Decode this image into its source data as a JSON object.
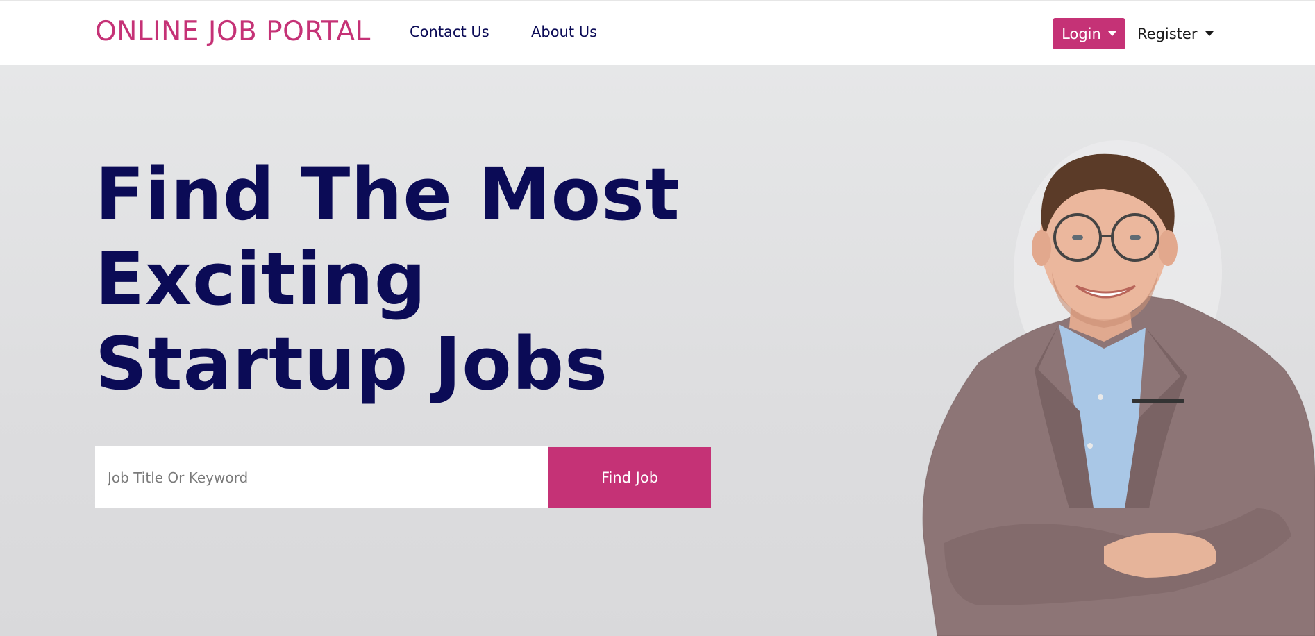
{
  "brand": {
    "name": "ONLINE JOB PORTAL",
    "color": "#c53276"
  },
  "nav": {
    "links": [
      {
        "label": "Contact Us"
      },
      {
        "label": "About Us"
      }
    ],
    "login_label": "Login",
    "register_label": "Register"
  },
  "hero": {
    "title_lines": [
      "Find The Most",
      "Exciting",
      "Startup Jobs"
    ],
    "search": {
      "placeholder": "Job Title Or Keyword",
      "value": "",
      "button_label": "Find Job"
    }
  },
  "colors": {
    "accent": "#c53276",
    "navy": "#0b0b56",
    "hero_bg": "#e4e4e5"
  }
}
